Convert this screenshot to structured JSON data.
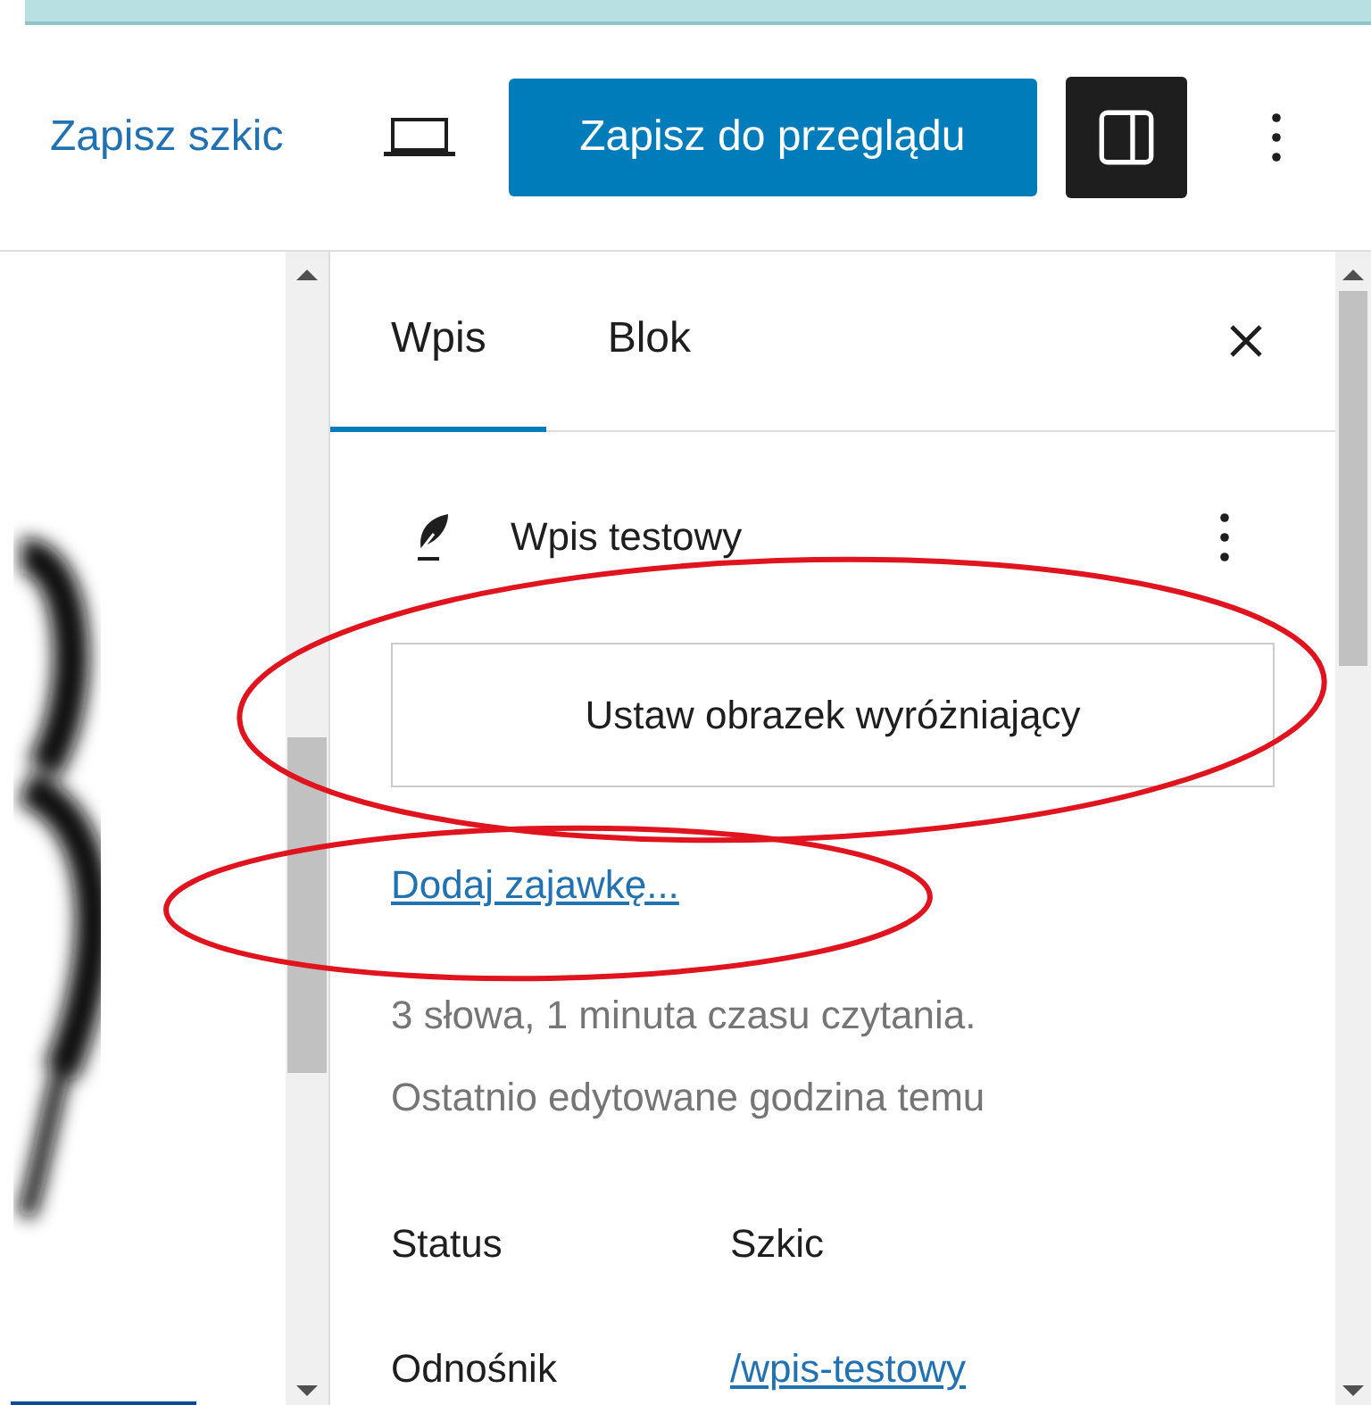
{
  "header": {
    "save_draft": "Zapisz szkic",
    "submit": "Zapisz do przeglądu",
    "sidebar_open": true
  },
  "sidebar": {
    "tabs": [
      {
        "label": "Wpis",
        "selected": true
      },
      {
        "label": "Blok",
        "selected": false
      }
    ],
    "post_title": "Wpis testowy",
    "featured_image_button": "Ustaw obrazek wyróżniający",
    "excerpt_link": "Dodaj zajawkę...",
    "stats": "3 słowa, 1 minuta czasu czytania.",
    "last_edited": "Ostatnio edytowane godzina temu",
    "fields": [
      {
        "label": "Status",
        "value": "Szkic",
        "kind": "text"
      },
      {
        "label": "Odnośnik",
        "value": "/wpis-testowy",
        "kind": "link"
      }
    ]
  }
}
